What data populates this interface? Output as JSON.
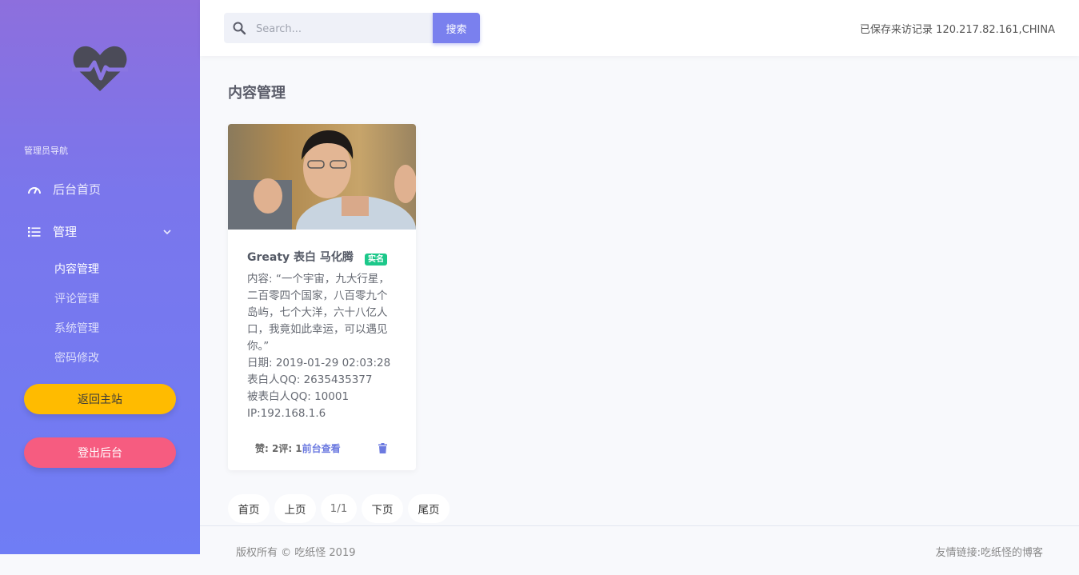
{
  "sidebar": {
    "nav_heading": "管理员导航",
    "items": [
      {
        "label": "后台首页",
        "icon": "dashboard-icon"
      },
      {
        "label": "管理",
        "icon": "list-icon"
      }
    ],
    "sub_items": [
      "内容管理",
      "评论管理",
      "系统管理",
      "密码修改"
    ],
    "back_button": "返回主站",
    "logout_button": "登出后台"
  },
  "topbar": {
    "search_placeholder": "Search...",
    "search_button": "搜索",
    "visitor_text": "已保存来访记录 120.217.82.161,CHINA"
  },
  "main": {
    "page_title": "内容管理",
    "card": {
      "title": "Greaty 表白 马化腾",
      "badge": "实名",
      "lines": [
        "内容: “一个宇宙，九大行星，",
        "二百零四个国家，八百零九个",
        "岛屿，七个大洋，六十八亿人",
        "口，我竟如此幸运，可以遇见",
        "你。”",
        "日期: 2019-01-29 02:03:28",
        "表白人QQ: 2635435377",
        "被表白人QQ: 10001",
        "IP:192.168.1.6"
      ],
      "footer_stats": "赞: 2评: 1",
      "view_link": "前台查看"
    },
    "pagination": [
      "首页",
      "上页",
      "1/1",
      "下页",
      "尾页"
    ]
  },
  "footer": {
    "copyright": "版权所有 © 吃纸怪 2019",
    "links": "友情链接:吃纸怪的博客"
  },
  "colors": {
    "accent": "#7a80ee",
    "warning": "#ffbb00",
    "danger": "#f65c80",
    "success": "#1cc88a"
  }
}
